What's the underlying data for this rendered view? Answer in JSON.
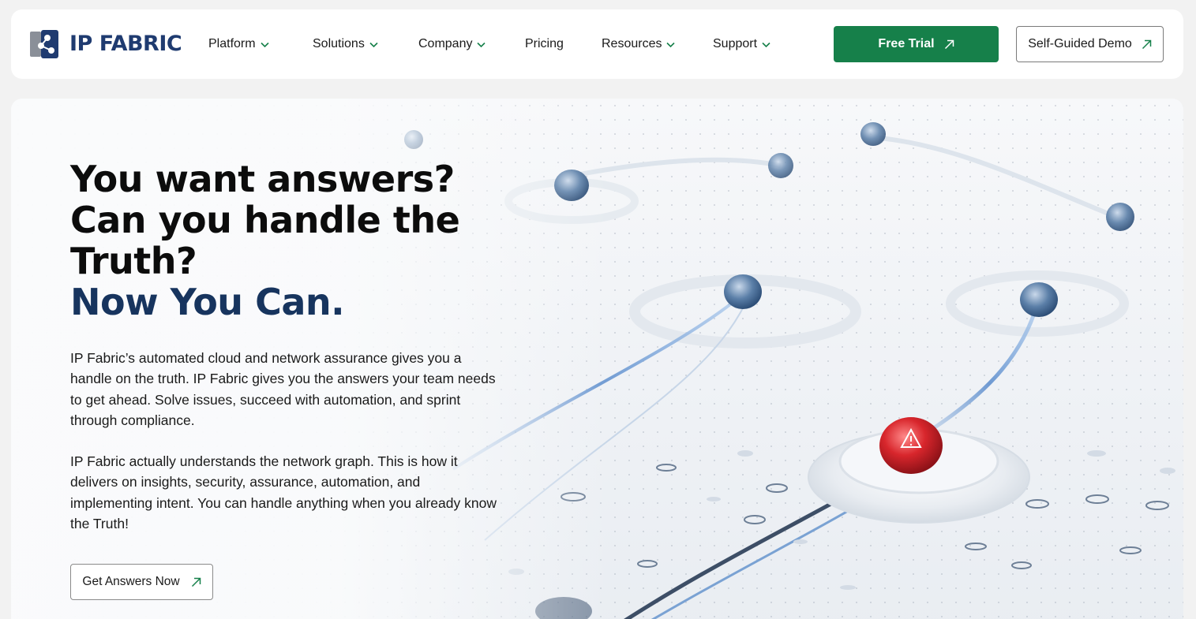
{
  "brand": {
    "name": "IP FABRIC",
    "color": "#1f3b70",
    "accent": "#16804a"
  },
  "nav": [
    {
      "label": "Platform",
      "has_menu": true
    },
    {
      "label": "Solutions",
      "has_menu": true
    },
    {
      "label": "Company",
      "has_menu": true
    },
    {
      "label": "Pricing",
      "has_menu": false
    },
    {
      "label": "Resources",
      "has_menu": true
    },
    {
      "label": "Support",
      "has_menu": true
    }
  ],
  "cta": {
    "trial_label": "Free Trial",
    "demo_label": "Self-Guided Demo"
  },
  "hero": {
    "headline_lines": [
      "You want answers?",
      "Can you handle the",
      "Truth?"
    ],
    "headline_accent": "Now You Can.",
    "paragraphs": [
      "IP Fabric’s automated cloud and network assurance gives you a handle on the truth. IP Fabric gives you the answers your team needs to get ahead. Solve issues, succeed with automation, and sprint through compliance.",
      "IP Fabric actually understands the network graph. This is how it delivers on insights, security, assurance, automation, and implementing intent. You can handle anything when you already know the Truth!"
    ],
    "button_label": "Get Answers Now",
    "image_description_icon": "network-alert-illustration"
  },
  "icons": {
    "chevron": "chevron-down-icon",
    "arrow": "arrow-up-right-icon"
  }
}
